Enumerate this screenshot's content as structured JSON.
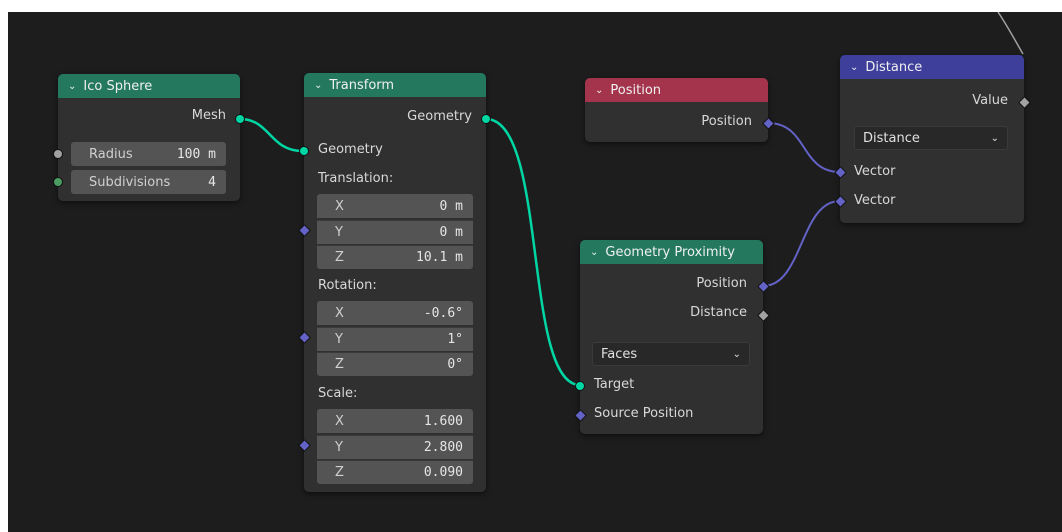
{
  "colors": {
    "geometry_socket": "#00d6a3",
    "vector_socket": "#6363c7",
    "float_socket": "#a1a1a1",
    "int_socket": "#4a9c62",
    "header_geometry": "#23785e",
    "header_input": "#a3344b",
    "header_vector": "#3e3f9b",
    "canvas_bg": "#1d1d1d",
    "node_bg": "#303030"
  },
  "ico_sphere": {
    "title": "Ico Sphere",
    "output_mesh": "Mesh",
    "radius": {
      "label": "Radius",
      "value": "100 m"
    },
    "subdivisions": {
      "label": "Subdivisions",
      "value": "4"
    }
  },
  "transform": {
    "title": "Transform",
    "output_geometry": "Geometry",
    "input_geometry": "Geometry",
    "translation_label": "Translation:",
    "translation": [
      {
        "axis": "X",
        "value": "0 m"
      },
      {
        "axis": "Y",
        "value": "0 m"
      },
      {
        "axis": "Z",
        "value": "10.1 m"
      }
    ],
    "rotation_label": "Rotation:",
    "rotation": [
      {
        "axis": "X",
        "value": "-0.6°"
      },
      {
        "axis": "Y",
        "value": "1°"
      },
      {
        "axis": "Z",
        "value": "0°"
      }
    ],
    "scale_label": "Scale:",
    "scale": [
      {
        "axis": "X",
        "value": "1.600"
      },
      {
        "axis": "Y",
        "value": "2.800"
      },
      {
        "axis": "Z",
        "value": "0.090"
      }
    ]
  },
  "position": {
    "title": "Position",
    "output_position": "Position"
  },
  "geometry_proximity": {
    "title": "Geometry Proximity",
    "output_position": "Position",
    "output_distance": "Distance",
    "mode": "Faces",
    "input_target": "Target",
    "input_source_position": "Source Position"
  },
  "distance": {
    "title": "Distance",
    "output_value": "Value",
    "operation": "Distance",
    "input_vector_1": "Vector",
    "input_vector_2": "Vector"
  },
  "icons": {
    "collapse": "⌄",
    "dropdown": "⌄"
  }
}
